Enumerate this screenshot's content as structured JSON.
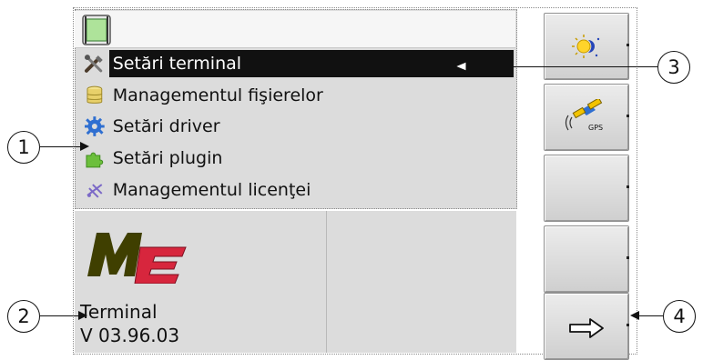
{
  "menu": {
    "items": [
      {
        "label": "Setări terminal",
        "icon": "tools-icon",
        "selected": true
      },
      {
        "label": "Managementul fişierelor",
        "icon": "database-icon",
        "selected": false
      },
      {
        "label": "Setări driver",
        "icon": "gear-icon",
        "selected": false
      },
      {
        "label": "Setări plugin",
        "icon": "puzzle-icon",
        "selected": false
      },
      {
        "label": "Managementul licenţei",
        "icon": "license-icon",
        "selected": false
      }
    ]
  },
  "info": {
    "logo_text": "ME",
    "app_name": "Terminal",
    "version": "V 03.96.03"
  },
  "softkeys": [
    {
      "icon": "day-night-icon"
    },
    {
      "icon": "gps-icon",
      "label": "GPS"
    },
    {
      "icon": "empty"
    },
    {
      "icon": "empty"
    },
    {
      "icon": "next-arrow-icon"
    }
  ],
  "callouts": [
    "1",
    "2",
    "3",
    "4"
  ],
  "colors": {
    "panel": "#dcdcdc",
    "selection": "#111111",
    "logo_dark": "#3f3f00",
    "logo_red": "#d7263d"
  }
}
